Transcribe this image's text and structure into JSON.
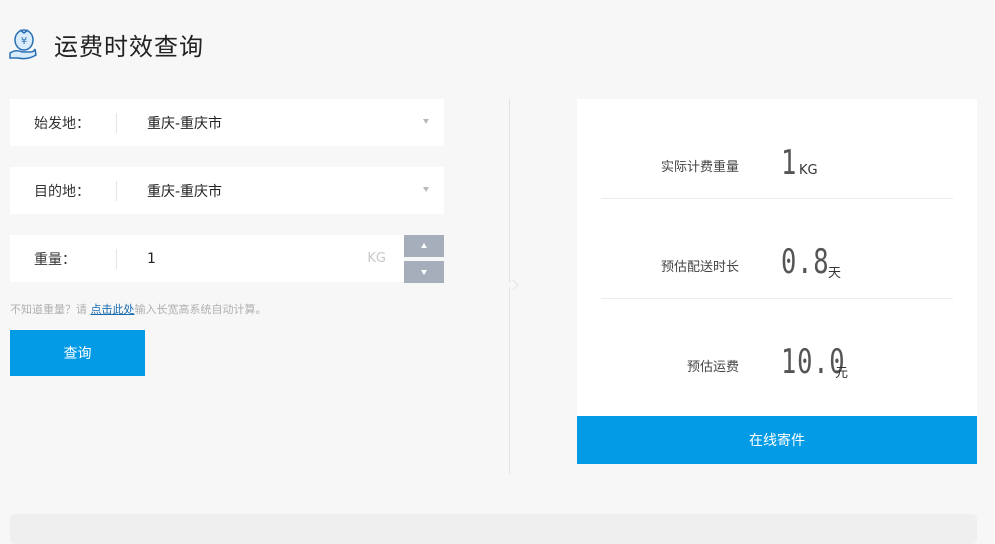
{
  "header": {
    "title": "运费时效查询",
    "icon": "money-bag-hand-icon"
  },
  "form": {
    "origin": {
      "label": "始发地：",
      "value": "重庆-重庆市"
    },
    "destination": {
      "label": "目的地：",
      "value": "重庆-重庆市"
    },
    "weight": {
      "label": "重量：",
      "value": "1",
      "unit": "KG"
    },
    "hint": {
      "prefix": "不知道重量？请 ",
      "link": "点击此处",
      "suffix": "输入长宽高系统自动计算。"
    },
    "query_label": "查询"
  },
  "result": {
    "weight": {
      "label": "实际计费重量",
      "value": "1",
      "unit": "KG"
    },
    "time": {
      "label": "预估配送时长",
      "value": "0.8",
      "unit": "天"
    },
    "fee": {
      "label": "预估运费",
      "value": "10.0",
      "unit": "元"
    },
    "ship_label": "在线寄件"
  },
  "colors": {
    "accent": "#039be5",
    "stepper": "#a7aebb",
    "background": "#f7f7f7"
  }
}
